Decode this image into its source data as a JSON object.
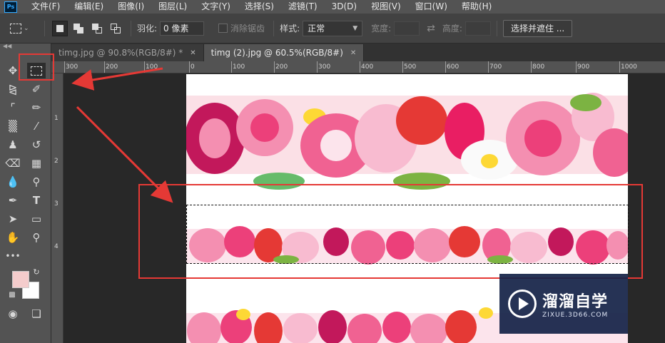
{
  "app": {
    "logo_text": "Ps"
  },
  "menubar": {
    "items": [
      "文件(F)",
      "编辑(E)",
      "图像(I)",
      "图层(L)",
      "文字(Y)",
      "选择(S)",
      "滤镜(T)",
      "3D(D)",
      "视图(V)",
      "窗口(W)",
      "帮助(H)"
    ]
  },
  "options": {
    "feather_label": "羽化:",
    "feather_value": "0 像素",
    "antialias_label": "消除锯齿",
    "style_label": "样式:",
    "style_value": "正常",
    "width_label": "宽度:",
    "height_label": "高度:",
    "select_mask_button": "选择并遮住 ..."
  },
  "tabs": [
    {
      "label": "timg.jpg @ 90.8%(RGB/8#) *",
      "active": false
    },
    {
      "label": "timg (2).jpg @ 60.5%(RGB/8#)",
      "active": true
    }
  ],
  "ruler": {
    "top_labels": [
      "300",
      "200",
      "100",
      "0",
      "100",
      "200",
      "300",
      "400",
      "500",
      "600",
      "700",
      "800",
      "900",
      "1000"
    ],
    "left_labels": [
      "1",
      "2",
      "3",
      "4"
    ]
  },
  "colors": {
    "foreground": "#f4cccc",
    "background": "#ffffff",
    "annotation": "#e53935"
  },
  "watermark": {
    "title": "溜溜自学",
    "url": "ZIXUE.3D66.COM"
  }
}
